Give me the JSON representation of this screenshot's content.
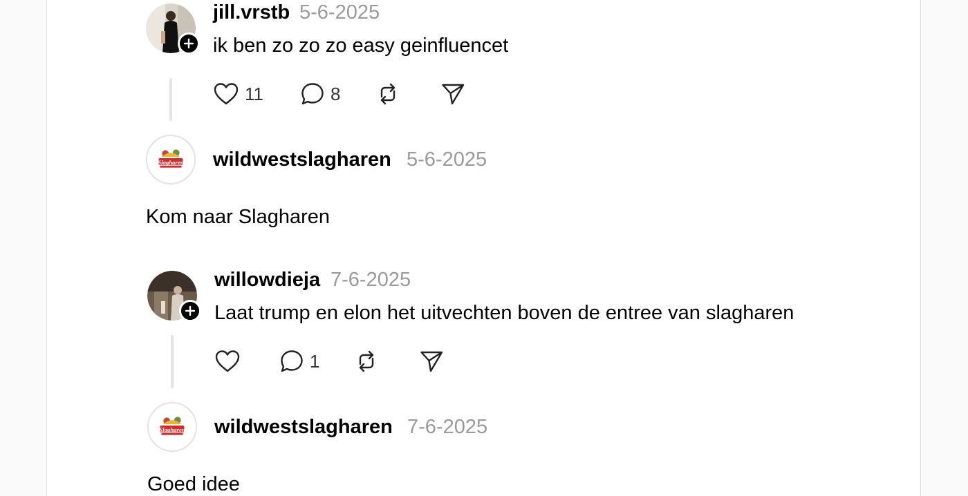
{
  "comments": [
    {
      "username": "jill.vrstb",
      "date": "5-6-2025",
      "text": "ik ben zo zo zo easy geinfluencet",
      "likes": "11",
      "replies": "8"
    },
    {
      "username": "wildwestslagharen",
      "date": "5-6-2025",
      "text": "Kom naar Slagharen"
    },
    {
      "username": "willowdieja",
      "date": "7-6-2025",
      "text": "Laat trump en elon het uitvechten boven de entree van slagharen",
      "likes": "",
      "replies": "1"
    },
    {
      "username": "wildwestslagharen",
      "date": "7-6-2025",
      "text": "Goed idee"
    }
  ],
  "logo": {
    "text": "Slagharen",
    "accent": "#d62b2b"
  },
  "colors": {
    "muted": "#9a9a9a",
    "text": "#000000",
    "line": "#e3e3e3"
  }
}
